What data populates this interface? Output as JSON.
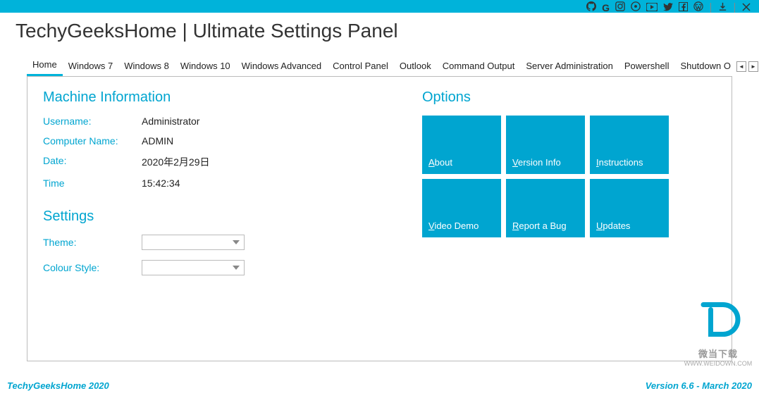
{
  "title": "TechyGeeksHome | Ultimate Settings Panel",
  "tabs": [
    "Home",
    "Windows 7",
    "Windows 8",
    "Windows 10",
    "Windows Advanced",
    "Control Panel",
    "Outlook",
    "Command Output",
    "Server Administration",
    "Powershell",
    "Shutdown O"
  ],
  "machine": {
    "heading": "Machine Information",
    "labels": {
      "username": "Username:",
      "computer": "Computer Name:",
      "date": "Date:",
      "time": "Time"
    },
    "values": {
      "username": "Administrator",
      "computer": "ADMIN",
      "date": "2020年2月29日",
      "time": "15:42:34"
    }
  },
  "settings": {
    "heading": "Settings",
    "labels": {
      "theme": "Theme:",
      "colour": "Colour Style:"
    }
  },
  "options": {
    "heading": "Options",
    "tiles": [
      {
        "accesskey": "A",
        "rest": "bout"
      },
      {
        "accesskey": "V",
        "rest": "ersion Info"
      },
      {
        "accesskey": "I",
        "rest": "nstructions"
      },
      {
        "accesskey": "V",
        "rest": "ideo Demo"
      },
      {
        "accesskey": "R",
        "rest": "eport a Bug"
      },
      {
        "accesskey": "U",
        "rest": "pdates"
      }
    ]
  },
  "footer": {
    "left": "TechyGeeksHome 2020",
    "right": "Version 6.6 - March 2020"
  },
  "watermark": {
    "cn": "微当下载",
    "url": "WWW.WEIDOWN.COM"
  }
}
